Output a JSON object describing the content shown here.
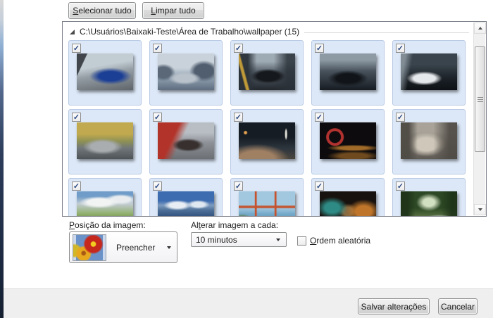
{
  "toolbar": {
    "select_all": {
      "key": "S",
      "rest": "elecionar tudo"
    },
    "clear_all": {
      "key": "L",
      "rest": "impar tudo"
    }
  },
  "list": {
    "group_path": "C:\\Usuários\\Baixaki-Teste\\Área de Trabalho\\wallpaper (15)",
    "thumbnails": [
      {
        "desc": "blue sports car on mountain road",
        "checked": true
      },
      {
        "desc": "silver car by coastal rocks",
        "checked": true
      },
      {
        "desc": "black car in dark city street",
        "checked": true
      },
      {
        "desc": "dark sedan under cloudy sky",
        "checked": true
      },
      {
        "desc": "white convertible in dark garage",
        "checked": true
      },
      {
        "desc": "silver porsche on autumn road",
        "checked": true
      },
      {
        "desc": "red race car on track",
        "checked": true
      },
      {
        "desc": "night highway light trails with tower",
        "checked": true
      },
      {
        "desc": "red ferris wheel at night",
        "checked": true
      },
      {
        "desc": "sepia city street scene",
        "checked": true
      },
      {
        "desc": "green valley with dramatic clouds",
        "checked": true
      },
      {
        "desc": "mountain lake with snowy peaks",
        "checked": true
      },
      {
        "desc": "golden gate bridge over blue water",
        "checked": true
      },
      {
        "desc": "teal and orange abstract bokeh",
        "checked": true
      },
      {
        "desc": "silver car on forest road",
        "checked": true
      }
    ]
  },
  "controls": {
    "position_label": {
      "pre": "",
      "key": "P",
      "rest": "osição da imagem:"
    },
    "position_value": "Preencher",
    "interval_label": {
      "pre": "Al",
      "key": "t",
      "rest": "erar imagem a cada:"
    },
    "interval_value": "10 minutos",
    "shuffle_label": {
      "pre": "",
      "key": "O",
      "rest": "rdem aleatória"
    },
    "shuffle_checked": false
  },
  "footer": {
    "save": "Salvar alterações",
    "cancel": "Cancelar"
  },
  "colors": {
    "cell_bg": "#dce8f7",
    "cell_border": "#b8c9e4",
    "check": "#2b4a84"
  }
}
